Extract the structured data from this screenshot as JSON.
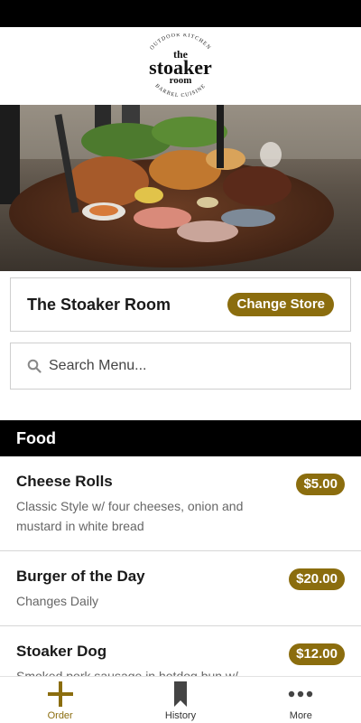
{
  "header": {
    "logo": {
      "arc_top": "OUTDOOR KITCHEN",
      "the": "the",
      "name": "stoaker",
      "room": "room",
      "arc_bottom": "BARREL CUISINE"
    }
  },
  "store": {
    "name": "The Stoaker Room",
    "change_label": "Change Store"
  },
  "search": {
    "placeholder": "Search Menu..."
  },
  "menu": {
    "section_title": "Food",
    "items": [
      {
        "title": "Cheese Rolls",
        "description": "Classic Style w/ four cheeses, onion and mustard in white bread",
        "price": "$5.00"
      },
      {
        "title": "Burger of the Day",
        "description": "Changes Daily",
        "price": "$20.00"
      },
      {
        "title": "Stoaker Dog",
        "description": "Smoked pork sausage in hotdog bun w/",
        "price": "$12.00"
      }
    ]
  },
  "tabs": [
    {
      "label": "Order",
      "icon": "plus-icon",
      "active": true
    },
    {
      "label": "History",
      "icon": "bookmark-icon",
      "active": false
    },
    {
      "label": "More",
      "icon": "more-dots-icon",
      "active": false
    }
  ],
  "colors": {
    "accent": "#8b6d0e",
    "header_bar": "#000000"
  }
}
